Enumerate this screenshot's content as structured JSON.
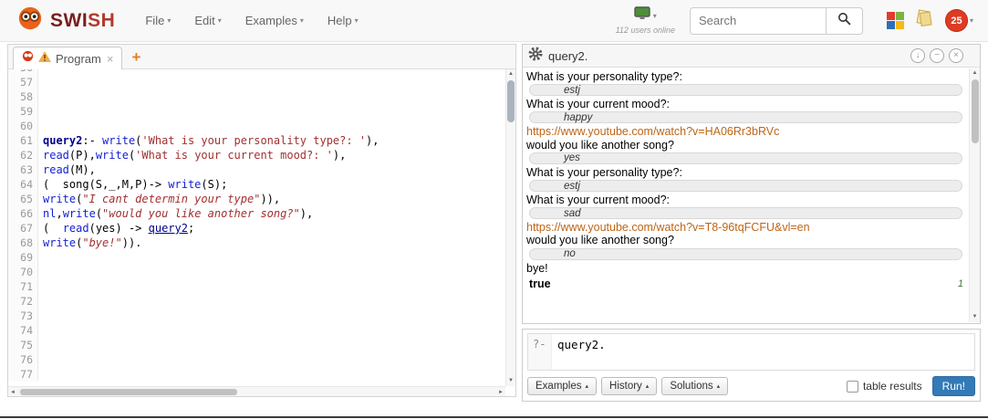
{
  "colors": {
    "brand_swi": "#7a1d1d",
    "brand_sh": "#b03a2e",
    "output_link": "#bf6516",
    "run_button": "#337ab7",
    "answer_number_green": "#3c763d",
    "badge_red": "#dd3c23",
    "new_tab_orange": "#e87e1b"
  },
  "navbar": {
    "brand": {
      "swi": "SWI",
      "sh": "SH"
    },
    "menus": [
      "File",
      "Edit",
      "Examples",
      "Help"
    ],
    "users_online": "112 users online",
    "search": {
      "placeholder": "Search"
    },
    "badge_count": "25"
  },
  "tabs": {
    "program_label": "Program"
  },
  "editor": {
    "first_line": 56,
    "lines": [
      [],
      [],
      [],
      [],
      [],
      [
        {
          "t": "query2",
          "c": "hd"
        },
        {
          "t": ":- ",
          "c": "p"
        },
        {
          "t": "write",
          "c": "bi"
        },
        {
          "t": "(",
          "c": "p"
        },
        {
          "t": "'What is your personality type?: '",
          "c": "at"
        },
        {
          "t": "),",
          "c": "p"
        }
      ],
      [
        {
          "t": "read",
          "c": "bi"
        },
        {
          "t": "(P),",
          "c": "p"
        },
        {
          "t": "write",
          "c": "bi"
        },
        {
          "t": "(",
          "c": "p"
        },
        {
          "t": "'What is your current mood?: '",
          "c": "at"
        },
        {
          "t": "),",
          "c": "p"
        }
      ],
      [
        {
          "t": "read",
          "c": "bi"
        },
        {
          "t": "(M),",
          "c": "p"
        }
      ],
      [
        {
          "t": "(  song(S,_,M,P)-> ",
          "c": "p"
        },
        {
          "t": "write",
          "c": "bi"
        },
        {
          "t": "(S);",
          "c": "p"
        }
      ],
      [
        {
          "t": "write",
          "c": "bi"
        },
        {
          "t": "(",
          "c": "p"
        },
        {
          "t": "\"I cant determin your type\"",
          "c": "st"
        },
        {
          "t": ")),",
          "c": "p"
        }
      ],
      [
        {
          "t": "nl",
          "c": "bi"
        },
        {
          "t": ",",
          "c": "p"
        },
        {
          "t": "write",
          "c": "bi"
        },
        {
          "t": "(",
          "c": "p"
        },
        {
          "t": "\"would you like another song?\"",
          "c": "st"
        },
        {
          "t": "),",
          "c": "p"
        }
      ],
      [
        {
          "t": "(  ",
          "c": "p"
        },
        {
          "t": "read",
          "c": "bi"
        },
        {
          "t": "(yes) -> ",
          "c": "p"
        },
        {
          "t": "query2",
          "c": "ln"
        },
        {
          "t": ";",
          "c": "p"
        }
      ],
      [
        {
          "t": "write",
          "c": "bi"
        },
        {
          "t": "(",
          "c": "p"
        },
        {
          "t": "\"bye!\"",
          "c": "st"
        },
        {
          "t": ")).",
          "c": "p"
        }
      ],
      [],
      [],
      [],
      [],
      [],
      [],
      [],
      [],
      []
    ]
  },
  "runner": {
    "title": "query2.",
    "entries": [
      {
        "kind": "text",
        "text": "What is your personality type?:"
      },
      {
        "kind": "input",
        "text": "estj"
      },
      {
        "kind": "text",
        "text": "What is your current mood?:"
      },
      {
        "kind": "input",
        "text": "happy"
      },
      {
        "kind": "link",
        "text": "https://www.youtube.com/watch?v=HA06Rr3bRVc"
      },
      {
        "kind": "text",
        "text": "would you like another song?"
      },
      {
        "kind": "input",
        "text": "yes"
      },
      {
        "kind": "text",
        "text": "What is your personality type?:"
      },
      {
        "kind": "input",
        "text": "estj"
      },
      {
        "kind": "text",
        "text": "What is your current mood?:"
      },
      {
        "kind": "input",
        "text": "sad"
      },
      {
        "kind": "link",
        "text": "https://www.youtube.com/watch?v=T8-96tqFCFU&vl=en"
      },
      {
        "kind": "text",
        "text": "would you like another song?"
      },
      {
        "kind": "input",
        "text": "no"
      },
      {
        "kind": "text",
        "text": "bye!"
      },
      {
        "kind": "result",
        "text": "true",
        "answer_no": "1"
      }
    ],
    "query": {
      "prompt": "?-",
      "text": "query2."
    },
    "controls": {
      "buttons": [
        "Examples",
        "History",
        "Solutions"
      ],
      "table_results": "table results",
      "run": "Run!"
    }
  },
  "icons": {
    "caret_down": "▾",
    "caret_up": "▴",
    "close": "×",
    "plus": "+",
    "download": "↓",
    "minimize": "−",
    "triangle_up": "▲",
    "triangle_down": "▼",
    "triangle_left": "◄",
    "triangle_right": "►"
  }
}
